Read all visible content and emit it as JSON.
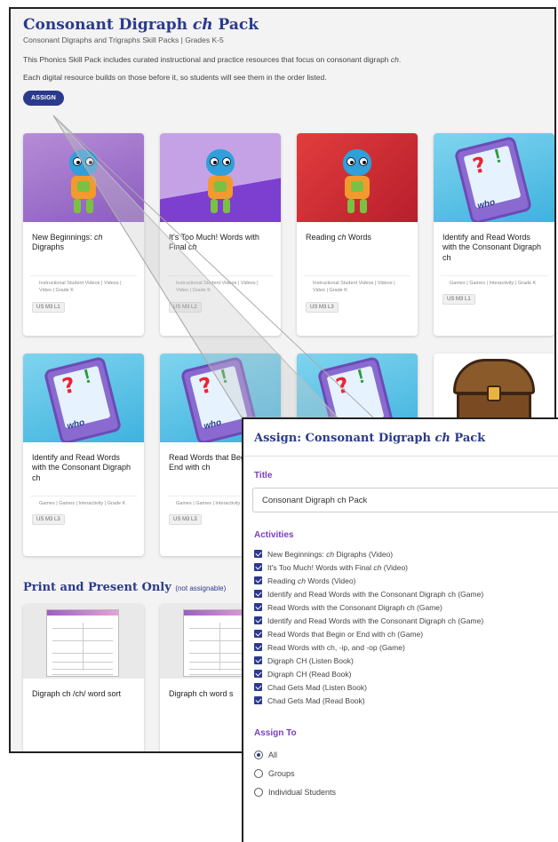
{
  "page": {
    "title_prefix": "Consonant Digraph ",
    "title_italic": "ch",
    "title_suffix": " Pack",
    "subtitle": "Consonant Digraphs and Trigraphs Skill Packs | Grades K-5",
    "desc1_prefix": "This Phonics Skill Pack includes curated instructional and practice resources that focus on consonant digraph ",
    "desc1_italic": "ch",
    "desc1_suffix": ".",
    "desc2": "Each digital resource builds on those before it, so students will see them in the order listed.",
    "assign_label": "ASSIGN"
  },
  "cards": [
    {
      "title_pre": "New Beginnings: ",
      "title_it": "ch",
      "title_post": " Digraphs",
      "meta": "Instructional Student Videos | Videos | Video | Grade K",
      "tag": "US M3 L1",
      "thumb": "robot",
      "color": "purple"
    },
    {
      "title_pre": "It's Too Much! Words with Final ",
      "title_it": "ch",
      "title_post": "",
      "meta": "Instructional Student Videos | Videos | Video | Grade K",
      "tag": "US M3 L2",
      "thumb": "robot",
      "color": "purple2"
    },
    {
      "title_pre": "Reading ",
      "title_it": "ch",
      "title_post": " Words",
      "meta": "Instructional Student Videos | Videos | Video | Grade K",
      "tag": "US M3 L3",
      "thumb": "robot",
      "color": "red"
    },
    {
      "title_pre": "Identify and Read Words with the Consonant Digraph ch",
      "title_it": "",
      "title_post": "",
      "meta": "Games | Games | Interactivity | Grade K",
      "tag": "US M3 L1",
      "thumb": "tablet",
      "color": "blue"
    },
    {
      "title_pre": "Identify and Read Words with the Consonant Digraph ch",
      "title_it": "",
      "title_post": "",
      "meta": "Games | Games | Interactivity | Grade K",
      "tag": "US M3 L3",
      "thumb": "tablet",
      "color": "blue"
    },
    {
      "title_pre": "Read Words that Begin or End with ch",
      "title_it": "",
      "title_post": "",
      "meta": "Games | Games | Interactivity | Grade K",
      "tag": "US M3 L3",
      "thumb": "tablet",
      "color": "blue"
    },
    {
      "title_pre": "",
      "title_it": "",
      "title_post": "",
      "meta": "",
      "tag": "",
      "thumb": "tablet",
      "color": "blue"
    },
    {
      "title_pre": "",
      "title_it": "",
      "title_post": "",
      "meta": "",
      "tag": "",
      "thumb": "chest",
      "color": "chest"
    }
  ],
  "print_section": {
    "title": "Print and Present Only",
    "note": "(not assignable)",
    "items": [
      "Digraph ch /ch/ word sort",
      "Digraph ch word s"
    ]
  },
  "modal": {
    "title_prefix": "Assign: Consonant Digraph ",
    "title_italic": "ch",
    "title_suffix": " Pack",
    "title_label": "Title",
    "title_value": "Consonant Digraph ch Pack",
    "activities_label": "Activities",
    "activities": [
      {
        "pre": "New Beginnings: ",
        "it": "ch",
        "post": " Digraphs (Video)"
      },
      {
        "pre": "It's Too Much! Words with Final ",
        "it": "ch",
        "post": " (Video)"
      },
      {
        "pre": "Reading ",
        "it": "ch",
        "post": " Words (Video)"
      },
      {
        "pre": "Identify and Read Words with the Consonant Digraph ch (Game)",
        "it": "",
        "post": ""
      },
      {
        "pre": "Read Words with the Consonant Digraph ch (Game)",
        "it": "",
        "post": ""
      },
      {
        "pre": "Identify and Read Words with the Consonant Digraph ch (Game)",
        "it": "",
        "post": ""
      },
      {
        "pre": "Read Words that Begin or End with ch (Game)",
        "it": "",
        "post": ""
      },
      {
        "pre": "Read Words with ch, -ip, and -op (Game)",
        "it": "",
        "post": ""
      },
      {
        "pre": "Digraph CH (Listen Book)",
        "it": "",
        "post": ""
      },
      {
        "pre": "Digraph CH (Read Book)",
        "it": "",
        "post": ""
      },
      {
        "pre": "Chad Gets Mad (Listen Book)",
        "it": "",
        "post": ""
      },
      {
        "pre": "Chad Gets Mad (Read Book)",
        "it": "",
        "post": ""
      }
    ],
    "assign_to_label": "Assign To",
    "assign_options": [
      "All",
      "Groups",
      "Individual Students"
    ],
    "selected_option": "All"
  }
}
